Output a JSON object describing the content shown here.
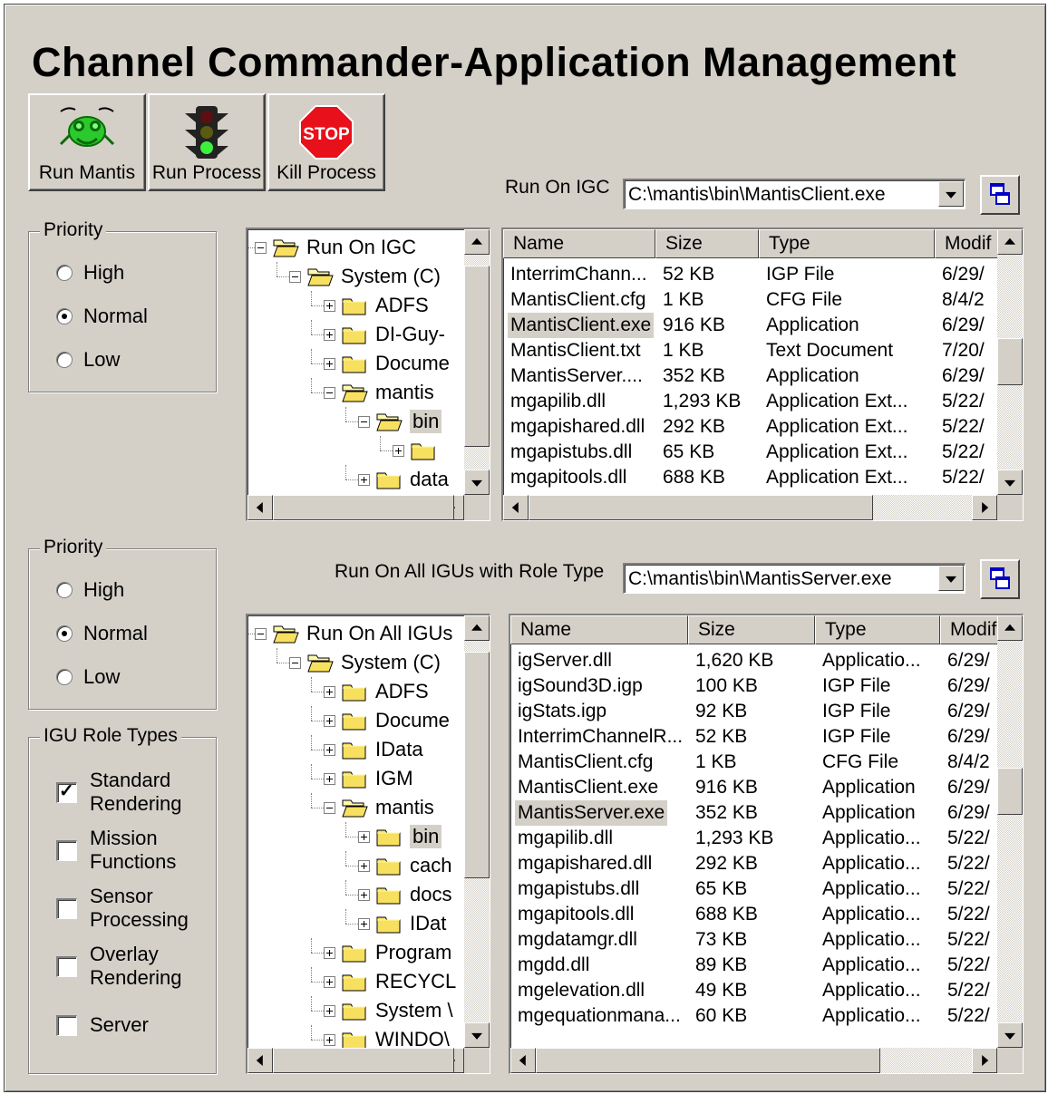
{
  "window": {
    "title": "Channel Commander-Application Management"
  },
  "toolbar": {
    "run_mantis": "Run Mantis",
    "run_process": "Run Process",
    "kill_process": "Kill Process",
    "stop_text": "STOP"
  },
  "colors": {
    "face": "#d4d0c8",
    "stop_red": "#e8101a",
    "mantis_green": "#2cc92c"
  },
  "top": {
    "priority": {
      "title": "Priority",
      "high": "High",
      "normal": "Normal",
      "low": "Low",
      "selected": "Normal"
    },
    "run_label": "Run On IGC",
    "combo_value": "C:\\mantis\\bin\\MantisClient.exe",
    "tree": [
      {
        "label": "Run On IGC",
        "toggle": "minus",
        "level": 0
      },
      {
        "label": "System (C)",
        "toggle": "minus",
        "level": 1
      },
      {
        "label": "ADFS",
        "toggle": "plus",
        "level": 2
      },
      {
        "label": "DI-Guy-",
        "toggle": "plus",
        "level": 2
      },
      {
        "label": "Docume",
        "toggle": "plus",
        "level": 2
      },
      {
        "label": "mantis",
        "toggle": "minus",
        "level": 2
      },
      {
        "label": "bin",
        "toggle": "minus",
        "level": 3,
        "selected": true
      },
      {
        "label": "",
        "toggle": "plus",
        "level": 4
      },
      {
        "label": "data",
        "toggle": "plus",
        "level": 3
      }
    ],
    "list": {
      "columns": [
        "Name",
        "Size",
        "Type",
        "Modif"
      ],
      "rows": [
        [
          "InterrimChann...",
          "52 KB",
          "IGP File",
          "6/29/"
        ],
        [
          "MantisClient.cfg",
          "1 KB",
          "CFG File",
          "8/4/2"
        ],
        [
          "MantisClient.exe",
          "916 KB",
          "Application",
          "6/29/"
        ],
        [
          "MantisClient.txt",
          "1 KB",
          "Text Document",
          "7/20/"
        ],
        [
          "MantisServer....",
          "352 KB",
          "Application",
          "6/29/"
        ],
        [
          "mgapilib.dll",
          "1,293 KB",
          "Application Ext...",
          "5/22/"
        ],
        [
          "mgapishared.dll",
          "292 KB",
          "Application Ext...",
          "5/22/"
        ],
        [
          "mgapistubs.dll",
          "65 KB",
          "Application Ext...",
          "5/22/"
        ],
        [
          "mgapitools.dll",
          "688 KB",
          "Application Ext...",
          "5/22/"
        ]
      ],
      "selected_row": 2
    }
  },
  "bottom": {
    "priority": {
      "title": "Priority",
      "high": "High",
      "normal": "Normal",
      "low": "Low",
      "selected": "Normal"
    },
    "run_label": "Run On All IGUs with Role Type",
    "combo_value": "C:\\mantis\\bin\\MantisServer.exe",
    "roles": {
      "title": "IGU Role Types",
      "items": [
        {
          "line1": "Standard",
          "line2": "Rendering",
          "checked": true
        },
        {
          "line1": "Mission",
          "line2": "Functions",
          "checked": false
        },
        {
          "line1": "Sensor",
          "line2": "Processing",
          "checked": false
        },
        {
          "line1": "Overlay",
          "line2": "Rendering",
          "checked": false
        },
        {
          "line1": "Server",
          "line2": "",
          "checked": false
        }
      ]
    },
    "tree": [
      {
        "label": "Run On All IGUs",
        "toggle": "minus",
        "level": 0
      },
      {
        "label": "System (C)",
        "toggle": "minus",
        "level": 1
      },
      {
        "label": "ADFS",
        "toggle": "plus",
        "level": 2
      },
      {
        "label": "Docume",
        "toggle": "plus",
        "level": 2
      },
      {
        "label": "IData",
        "toggle": "plus",
        "level": 2
      },
      {
        "label": "IGM",
        "toggle": "plus",
        "level": 2
      },
      {
        "label": "mantis",
        "toggle": "minus",
        "level": 2
      },
      {
        "label": "bin",
        "toggle": "plus",
        "level": 3,
        "selected": true
      },
      {
        "label": "cach",
        "toggle": "plus",
        "level": 3
      },
      {
        "label": "docs",
        "toggle": "plus",
        "level": 3
      },
      {
        "label": "IDat",
        "toggle": "plus",
        "level": 3
      },
      {
        "label": "Program",
        "toggle": "plus",
        "level": 2
      },
      {
        "label": "RECYCL",
        "toggle": "plus",
        "level": 2
      },
      {
        "label": "System \\",
        "toggle": "plus",
        "level": 2
      },
      {
        "label": "WINDO\\",
        "toggle": "plus",
        "level": 2
      }
    ],
    "list": {
      "columns": [
        "Name",
        "Size",
        "Type",
        "Modif"
      ],
      "rows": [
        [
          "igServer.dll",
          "1,620 KB",
          "Applicatio...",
          "6/29/"
        ],
        [
          "igSound3D.igp",
          "100 KB",
          "IGP File",
          "6/29/"
        ],
        [
          "igStats.igp",
          "92 KB",
          "IGP File",
          "6/29/"
        ],
        [
          "InterrimChannelR...",
          "52 KB",
          "IGP File",
          "6/29/"
        ],
        [
          "MantisClient.cfg",
          "1 KB",
          "CFG File",
          "8/4/2"
        ],
        [
          "MantisClient.exe",
          "916 KB",
          "Application",
          "6/29/"
        ],
        [
          "MantisServer.exe",
          "352 KB",
          "Application",
          "6/29/"
        ],
        [
          "mgapilib.dll",
          "1,293 KB",
          "Applicatio...",
          "5/22/"
        ],
        [
          "mgapishared.dll",
          "292 KB",
          "Applicatio...",
          "5/22/"
        ],
        [
          "mgapistubs.dll",
          "65 KB",
          "Applicatio...",
          "5/22/"
        ],
        [
          "mgapitools.dll",
          "688 KB",
          "Applicatio...",
          "5/22/"
        ],
        [
          "mgdatamgr.dll",
          "73 KB",
          "Applicatio...",
          "5/22/"
        ],
        [
          "mgdd.dll",
          "89 KB",
          "Applicatio...",
          "5/22/"
        ],
        [
          "mgelevation.dll",
          "49 KB",
          "Applicatio...",
          "5/22/"
        ],
        [
          "mgequationmana...",
          "60 KB",
          "Applicatio...",
          "5/22/"
        ]
      ],
      "selected_row": 6
    }
  }
}
